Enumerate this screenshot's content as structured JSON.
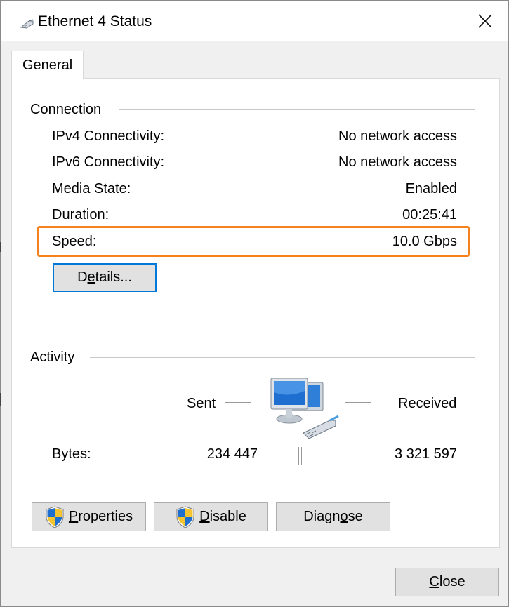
{
  "window": {
    "title": "Ethernet 4 Status",
    "close_glyph": "✕"
  },
  "tabs": [
    {
      "label": "General"
    }
  ],
  "connection": {
    "group_label": "Connection",
    "rows": [
      {
        "label": "IPv4 Connectivity:",
        "value": "No network access"
      },
      {
        "label": "IPv6 Connectivity:",
        "value": "No network access"
      },
      {
        "label": "Media State:",
        "value": "Enabled"
      },
      {
        "label": "Duration:",
        "value": "00:25:41"
      },
      {
        "label": "Speed:",
        "value": "10.0 Gbps"
      }
    ],
    "details_button": {
      "pre": "D",
      "mnemonic": "e",
      "post": "tails..."
    },
    "highlight_color": "#f5821f"
  },
  "activity": {
    "group_label": "Activity",
    "sent_label": "Sent",
    "received_label": "Received",
    "bytes_label": "Bytes:",
    "bytes_sent": "234 447",
    "bytes_received": "3 321 597",
    "icon": "network-computers-icon"
  },
  "buttons": {
    "properties": {
      "mnemonic": "P",
      "rest": "roperties",
      "icon": "uac-shield-icon"
    },
    "disable": {
      "mnemonic": "D",
      "rest": "isable",
      "icon": "uac-shield-icon"
    },
    "diagnose": {
      "pre": "Diagn",
      "mnemonic": "o",
      "post": "se"
    },
    "close": {
      "mnemonic": "C",
      "rest": "lose"
    }
  },
  "colors": {
    "focus_border": "#0078d7",
    "button_face": "#e1e1e1",
    "window_bg": "#f0f0f0"
  }
}
